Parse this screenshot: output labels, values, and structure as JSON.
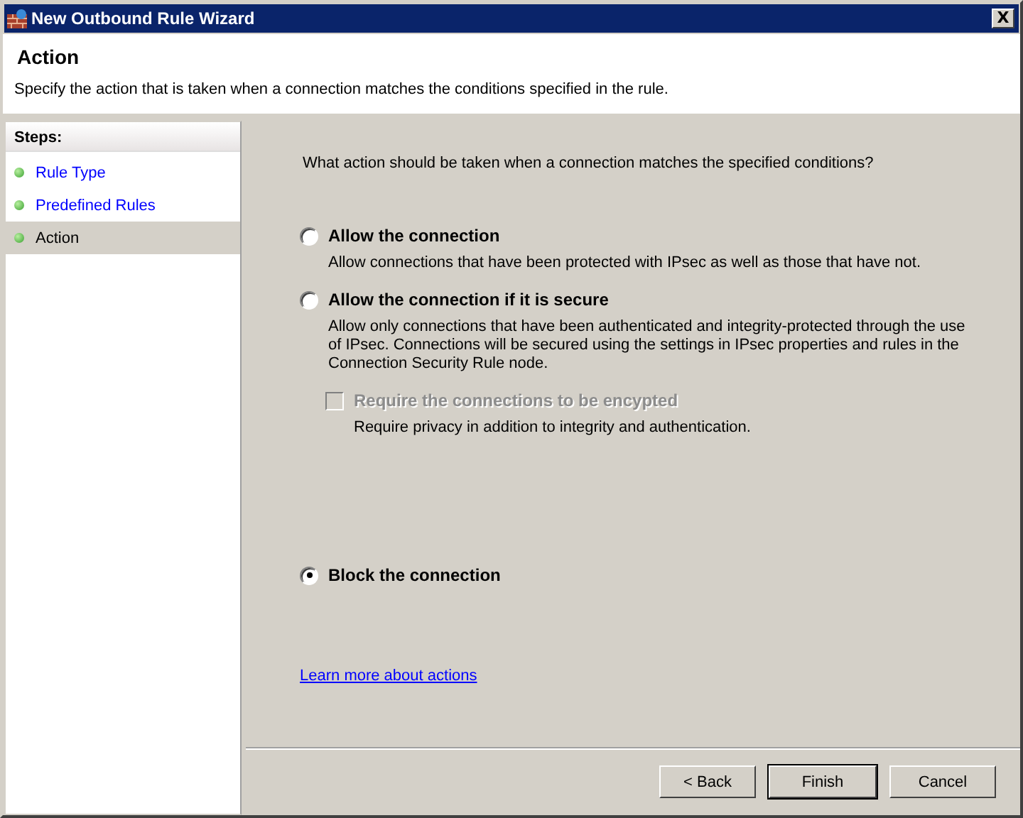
{
  "window": {
    "title": "New Outbound Rule Wizard",
    "close_label": "X"
  },
  "header": {
    "title": "Action",
    "description": "Specify the action that is taken when a connection matches the conditions specified in the rule."
  },
  "steps": {
    "heading": "Steps:",
    "items": [
      {
        "label": "Rule Type",
        "selected": false
      },
      {
        "label": "Predefined Rules",
        "selected": false
      },
      {
        "label": "Action",
        "selected": true
      }
    ]
  },
  "question": "What action should be taken when a connection matches the specified conditions?",
  "options": [
    {
      "kind": "radio",
      "label": "Allow the connection",
      "description": "Allow connections that have been protected with IPsec as well as those that have not.",
      "selected": false
    },
    {
      "kind": "radio",
      "label": "Allow the connection if it is secure",
      "description": "Allow only connections that have been authenticated and integrity-protected through the use of IPsec.  Connections will be secured using the settings in IPsec properties and rules in the Connection Security Rule node.",
      "selected": false
    },
    {
      "kind": "checkbox",
      "label": "Require the connections to be encypted",
      "description": "Require privacy in addition to integrity and authentication.",
      "checked": false,
      "disabled": true
    },
    {
      "kind": "radio",
      "label": "Block the connection",
      "selected": true
    }
  ],
  "link": "Learn more about actions",
  "buttons": [
    {
      "label": "< Back",
      "default": false
    },
    {
      "label": "Finish",
      "default": true
    },
    {
      "label": "Cancel",
      "default": false
    }
  ]
}
